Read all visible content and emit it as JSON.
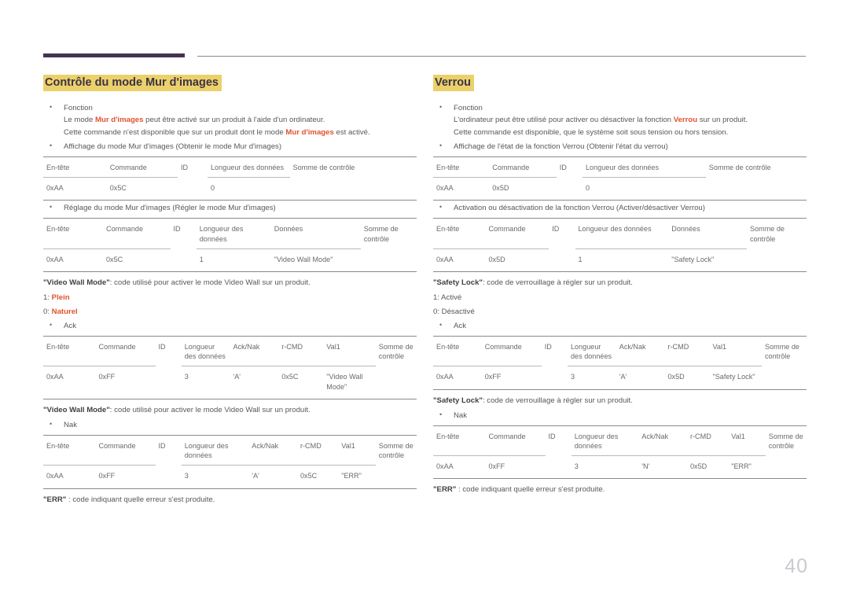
{
  "page": {
    "number": "40"
  },
  "left": {
    "title": "Contrôle du mode Mur d'images",
    "fonction_label": "Fonction",
    "fonction_line1_a": "Le mode ",
    "fonction_line1_em": "Mur d'images",
    "fonction_line1_b": " peut être activé sur un produit à l'aide d'un ordinateur.",
    "fonction_line2_a": "Cette commande n'est disponible que sur un produit dont le mode ",
    "fonction_line2_em": "Mur d'images",
    "fonction_line2_b": " est activé.",
    "get_bullet": "Affichage du mode Mur d'images (Obtenir le mode Mur d'images)",
    "get_table": {
      "headers": [
        "En-tête",
        "Commande",
        "ID",
        "Longueur des données",
        "Somme de contrôle"
      ],
      "row": [
        "0xAA",
        "0x5C",
        "",
        "0",
        ""
      ]
    },
    "set_bullet": "Réglage du mode Mur d'images (Régler le mode Mur d'images)",
    "set_table": {
      "headers": [
        "En-tête",
        "Commande",
        "ID",
        "Longueur des données",
        "Données",
        "Somme de contrôle"
      ],
      "row": [
        "0xAA",
        "0x5C",
        "",
        "1",
        "\"Video Wall Mode\"",
        ""
      ]
    },
    "note_vwm_1_em": "\"Video Wall Mode\"",
    "note_vwm_1_rest": ": code utilisé pour activer le mode Video Wall sur un produit.",
    "opt_1_num": "1: ",
    "opt_1_val": "Plein",
    "opt_0_num": "0: ",
    "opt_0_val": "Naturel",
    "ack_bullet": "Ack",
    "ack_table": {
      "headers": [
        "En-tête",
        "Commande",
        "ID",
        "Longueur des données",
        "Ack/Nak",
        "r-CMD",
        "Val1",
        "Somme de contrôle"
      ],
      "row": [
        "0xAA",
        "0xFF",
        "",
        "3",
        "'A'",
        "0x5C",
        "\"Video Wall Mode\"",
        ""
      ]
    },
    "note_vwm_2_em": "\"Video Wall Mode\"",
    "note_vwm_2_rest": ": code utilisé pour activer le mode Video Wall sur un produit.",
    "nak_bullet": "Nak",
    "nak_table": {
      "headers": [
        "En-tête",
        "Commande",
        "ID",
        "Longueur des données",
        "Ack/Nak",
        "r-CMD",
        "Val1",
        "Somme de contrôle"
      ],
      "row": [
        "0xAA",
        "0xFF",
        "",
        "3",
        "'A'",
        "0x5C",
        "\"ERR\"",
        ""
      ]
    },
    "note_err_em": "\"ERR\"",
    "note_err_rest": " : code indiquant quelle erreur s'est produite."
  },
  "right": {
    "title": "Verrou",
    "fonction_label": "Fonction",
    "fonction_line1_a": "L'ordinateur peut être utilisé pour activer ou désactiver la fonction ",
    "fonction_line1_em": "Verrou",
    "fonction_line1_b": " sur un produit.",
    "fonction_line2": "Cette commande est disponible, que le système soit sous tension ou hors tension.",
    "get_bullet": "Affichage de l'état de la fonction Verrou (Obtenir l'état du verrou)",
    "get_table": {
      "headers": [
        "En-tête",
        "Commande",
        "ID",
        "Longueur des données",
        "Somme de contrôle"
      ],
      "row": [
        "0xAA",
        "0x5D",
        "",
        "0",
        ""
      ]
    },
    "set_bullet": "Activation ou désactivation de la fonction Verrou (Activer/désactiver Verrou)",
    "set_table": {
      "headers": [
        "En-tête",
        "Commande",
        "ID",
        "Longueur des données",
        "Données",
        "Somme de contrôle"
      ],
      "row": [
        "0xAA",
        "0x5D",
        "",
        "1",
        "\"Safety Lock\"",
        ""
      ]
    },
    "note_sl_1_em": "\"Safety Lock\"",
    "note_sl_1_rest": ": code de verrouillage à régler sur un produit.",
    "opt_1": "1: Activé",
    "opt_0": "0: Désactivé",
    "ack_bullet": "Ack",
    "ack_table": {
      "headers": [
        "En-tête",
        "Commande",
        "ID",
        "Longueur des données",
        "Ack/Nak",
        "r-CMD",
        "Val1",
        "Somme de contrôle"
      ],
      "row": [
        "0xAA",
        "0xFF",
        "",
        "3",
        "'A'",
        "0x5D",
        "\"Safety Lock\"",
        ""
      ]
    },
    "note_sl_2_em": "\"Safety Lock\"",
    "note_sl_2_rest": ": code de verrouillage à régler sur un produit.",
    "nak_bullet": "Nak",
    "nak_table": {
      "headers": [
        "En-tête",
        "Commande",
        "ID",
        "Longueur des données",
        "Ack/Nak",
        "r-CMD",
        "Val1",
        "Somme de contrôle"
      ],
      "row": [
        "0xAA",
        "0xFF",
        "",
        "3",
        "'N'",
        "0x5D",
        "\"ERR\"",
        ""
      ]
    },
    "note_err_em": "\"ERR\"",
    "note_err_rest": " : code indiquant quelle erreur s'est produite."
  },
  "colors": {
    "header_bar": "#433351",
    "highlight": "#ecd16a",
    "accent": "#e0532f",
    "heading": "#3b3246",
    "body_text": "#58585b",
    "rule": "#8a8a8f",
    "page_number": "#c9c9d1"
  }
}
